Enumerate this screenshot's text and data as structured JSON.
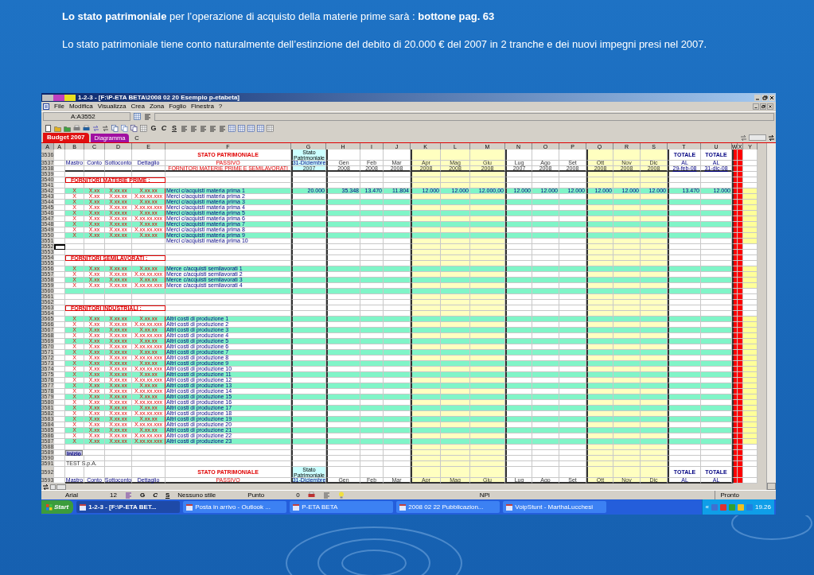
{
  "slide": {
    "title": "**Lo stato patrimoniale** per l’operazione di acquisto della materie prime sarà : **bottone pag. 63**",
    "text": "Lo stato patrimoniale tiene conto naturalmente dell’estinzione del debito di 20.000 € del 2007 in 2 tranche e dei nuovi impegni presi nel 2007."
  },
  "window": {
    "title": "1-2-3 - [F:\\P-ETA BETA\\2008 02 20  Esempio p-etabeta]"
  },
  "menu": [
    "File",
    "Modifica",
    "Visualizza",
    "Crea",
    "Zona",
    "Foglio",
    "Finestra",
    "?"
  ],
  "address": "A:A3552",
  "toolbar_letters": [
    "G",
    "C",
    "S"
  ],
  "tabs": [
    {
      "label": "Budget 2007",
      "selected": true,
      "color": "#e01010"
    },
    {
      "label": "Diagramma",
      "selected": false,
      "color": "#a010a0"
    },
    {
      "label": "C",
      "selected": false
    }
  ],
  "columns": [
    "A",
    "A",
    "B",
    "C",
    "D",
    "E",
    "F",
    "G",
    "H",
    "I",
    "J",
    "K",
    "L",
    "M",
    "N",
    "O",
    "P",
    "Q",
    "R",
    "S",
    "T",
    "U",
    "W",
    "X",
    "Y"
  ],
  "rows": [
    {
      "kind": "header",
      "numbers": [
        "3536",
        "3537",
        "3538"
      ],
      "labels": [
        "Mastro",
        "Conto",
        "Sottoconto",
        "Dettaglio"
      ],
      "title": "STATO PATRIMONIALE",
      "subtitle": "PASSIVO",
      "section": "FORNITORI MATERIE PRIME E SEMILAVORATI",
      "opening": {
        "title": "Stato Patrimoniale",
        "date": "31-Diciembre",
        "year": "2007"
      },
      "months": [
        {
          "name": "Gen",
          "year": "2008",
          "highlight": false
        },
        {
          "name": "Feb",
          "year": "2008",
          "highlight": false
        },
        {
          "name": "Mar",
          "year": "2008",
          "highlight": false
        },
        {
          "name": "Apr",
          "year": "2008",
          "highlight": true
        },
        {
          "name": "Mag",
          "year": "2008",
          "highlight": true
        },
        {
          "name": "Giu",
          "year": "2008",
          "highlight": true
        },
        {
          "name": "Lug",
          "year": "2007",
          "highlight": false
        },
        {
          "name": "Ago",
          "year": "2008",
          "highlight": false
        },
        {
          "name": "Set",
          "year": "2008",
          "highlight": false
        },
        {
          "name": "Ott",
          "year": "2008",
          "highlight": true
        },
        {
          "name": "Nov",
          "year": "2008",
          "highlight": true
        },
        {
          "name": "Dic",
          "year": "2008",
          "highlight": true
        }
      ],
      "totals": [
        {
          "label": "TOTALE",
          "al": "AL",
          "date": "29-feb-08"
        },
        {
          "label": "TOTALE",
          "al": "AL",
          "date": "31-dic-08"
        }
      ]
    },
    {
      "n": "3539",
      "kind": "blank",
      "shaded": false
    },
    {
      "n": "3540",
      "kind": "section",
      "label": "FORNITORI MATERIE PRIME :"
    },
    {
      "n": "3541",
      "kind": "blank",
      "shaded": false
    },
    {
      "n": "3542",
      "kind": "item",
      "shaded": true,
      "cells": [
        "X",
        "X.xx",
        "X.xx.xx",
        "X.xx.xx"
      ],
      "label": "Merci c/acquisti materia prima 1",
      "values": [
        "20.000",
        "35.348",
        "13.470",
        "11.804",
        "12.000",
        "12.000",
        "12.000,00",
        "12.000",
        "12.000",
        "12.000",
        "12.000",
        "12.000",
        "12.000",
        "13.470",
        "12.000"
      ]
    },
    {
      "n": "3543",
      "kind": "item",
      "shaded": false,
      "cells": [
        "X",
        "X.xx",
        "X.xx.xx",
        "X.xx.xx.xxx"
      ],
      "label": "Merci c/acquisti materia prima 2"
    },
    {
      "n": "3544",
      "kind": "item",
      "shaded": true,
      "cells": [
        "X",
        "X.xx",
        "X.xx.xx",
        "X.xx.xx"
      ],
      "label": "Merci c/acquisti materia prima 3"
    },
    {
      "n": "3545",
      "kind": "item",
      "shaded": false,
      "cells": [
        "X",
        "X.xx",
        "X.xx.xx",
        "X.xx.xx.xxx"
      ],
      "label": "Merci c/acquisti materia prima 4"
    },
    {
      "n": "3546",
      "kind": "item",
      "shaded": true,
      "cells": [
        "X",
        "X.xx",
        "X.xx.xx",
        "X.xx.xx"
      ],
      "label": "Merci c/acquisti materia prima 5"
    },
    {
      "n": "3547",
      "kind": "item",
      "shaded": false,
      "cells": [
        "X",
        "X.xx",
        "X.xx.xx",
        "X.xx.xx.xxx"
      ],
      "label": "Merci c/acquisti materia prima 6"
    },
    {
      "n": "3548",
      "kind": "item",
      "shaded": true,
      "cells": [
        "X",
        "X.xx",
        "X.xx.xx",
        "X.xx.xx"
      ],
      "label": "Merci c/acquisti materia prima 7"
    },
    {
      "n": "3549",
      "kind": "item",
      "shaded": false,
      "cells": [
        "X",
        "X.xx",
        "X.xx.xx",
        "X.xx.xx.xxx"
      ],
      "label": "Merci c/acquisti materia prima 8"
    },
    {
      "n": "3550",
      "kind": "item",
      "shaded": true,
      "cells": [
        "X",
        "X.xx",
        "X.xx.xx",
        "X.xx.xx"
      ],
      "label": "Merci c/acquisti materia prima 9"
    },
    {
      "n": "3551",
      "kind": "item",
      "shaded": false,
      "label": "Merci c/acquisti materia prima 10"
    },
    {
      "n": "3552",
      "kind": "blank",
      "shaded": false,
      "cursor": true
    },
    {
      "n": "3553",
      "kind": "blank",
      "shaded": false
    },
    {
      "n": "3554",
      "kind": "section",
      "label": "FORNITORI SEMILAVORATI :"
    },
    {
      "n": "3555",
      "kind": "blank",
      "shaded": false
    },
    {
      "n": "3556",
      "kind": "item",
      "shaded": true,
      "cells": [
        "X",
        "X.xx",
        "X.xx.xx",
        "X.xx.xx"
      ],
      "label": "Merce c/acquisti semilavorati 1"
    },
    {
      "n": "3557",
      "kind": "item",
      "shaded": false,
      "cells": [
        "X",
        "X.xx",
        "X.xx.xx",
        "X.xx.xx.xxx"
      ],
      "label": "Merce c/acquisti semilavorati 2"
    },
    {
      "n": "3558",
      "kind": "item",
      "shaded": true,
      "cells": [
        "X",
        "X.xx",
        "X.xx.xx",
        "X.xx.xx"
      ],
      "label": "Merce c/acquisti semilavorati 3"
    },
    {
      "n": "3559",
      "kind": "item",
      "shaded": false,
      "cells": [
        "X",
        "X.xx",
        "X.xx.xx",
        "X.xx.xx.xxx"
      ],
      "label": "Merce c/acquisti semilavorati 4"
    },
    {
      "n": "3560",
      "kind": "blank",
      "shaded": true
    },
    {
      "n": "3561",
      "kind": "blank",
      "shaded": false
    },
    {
      "n": "3562",
      "kind": "blank",
      "shaded": false
    },
    {
      "n": "3563",
      "kind": "section",
      "label": "FORNITORI INDUSTRIALI :"
    },
    {
      "n": "3564",
      "kind": "blank",
      "shaded": false
    },
    {
      "n": "3565",
      "kind": "item",
      "shaded": true,
      "cells": [
        "X",
        "X.xx",
        "X.xx.xx",
        "X.xx.xx"
      ],
      "label": "Altri costi di produzione 1"
    },
    {
      "n": "3566",
      "kind": "item",
      "shaded": false,
      "cells": [
        "X",
        "X.xx",
        "X.xx.xx",
        "X.xx.xx.xxx"
      ],
      "label": "Altri costi di produzione 2"
    },
    {
      "n": "3567",
      "kind": "item",
      "shaded": true,
      "cells": [
        "X",
        "X.xx",
        "X.xx.xx",
        "X.xx.xx"
      ],
      "label": "Altri costi di produzione 3"
    },
    {
      "n": "3568",
      "kind": "item",
      "shaded": false,
      "cells": [
        "X",
        "X.xx",
        "X.xx.xx",
        "X.xx.xx.xxx"
      ],
      "label": "Altri costi di produzione 4"
    },
    {
      "n": "3569",
      "kind": "item",
      "shaded": true,
      "cells": [
        "X",
        "X.xx",
        "X.xx.xx",
        "X.xx.xx"
      ],
      "label": "Altri costi di produzione 5"
    },
    {
      "n": "3570",
      "kind": "item",
      "shaded": false,
      "cells": [
        "X",
        "X.xx",
        "X.xx.xx",
        "X.xx.xx.xxx"
      ],
      "label": "Altri costi di produzione 6"
    },
    {
      "n": "3571",
      "kind": "item",
      "shaded": true,
      "cells": [
        "X",
        "X.xx",
        "X.xx.xx",
        "X.xx.xx"
      ],
      "label": "Altri costi di produzione 7"
    },
    {
      "n": "3572",
      "kind": "item",
      "shaded": false,
      "cells": [
        "X",
        "X.xx",
        "X.xx.xx",
        "X.xx.xx.xxx"
      ],
      "label": "Altri costi di produzione 8"
    },
    {
      "n": "3573",
      "kind": "item",
      "shaded": true,
      "cells": [
        "X",
        "X.xx",
        "X.xx.xx",
        "X.xx.xx"
      ],
      "label": "Altri costi di produzione 9"
    },
    {
      "n": "3574",
      "kind": "item",
      "shaded": false,
      "cells": [
        "X",
        "X.xx",
        "X.xx.xx",
        "X.xx.xx.xxx"
      ],
      "label": "Altri costi di produzione 10"
    },
    {
      "n": "3575",
      "kind": "item",
      "shaded": true,
      "cells": [
        "X",
        "X.xx",
        "X.xx.xx",
        "X.xx.xx"
      ],
      "label": "Altri costi di produzione 11"
    },
    {
      "n": "3576",
      "kind": "item",
      "shaded": false,
      "cells": [
        "X",
        "X.xx",
        "X.xx.xx",
        "X.xx.xx.xxx"
      ],
      "label": "Altri costi di produzione 12"
    },
    {
      "n": "3577",
      "kind": "item",
      "shaded": true,
      "cells": [
        "X",
        "X.xx",
        "X.xx.xx",
        "X.xx.xx"
      ],
      "label": "Altri costi di produzione 13"
    },
    {
      "n": "3578",
      "kind": "item",
      "shaded": false,
      "cells": [
        "X",
        "X.xx",
        "X.xx.xx",
        "X.xx.xx.xxx"
      ],
      "label": "Altri costi di produzione 14"
    },
    {
      "n": "3579",
      "kind": "item",
      "shaded": true,
      "cells": [
        "X",
        "X.xx",
        "X.xx.xx",
        "X.xx.xx"
      ],
      "label": "Altri costi di produzione 15"
    },
    {
      "n": "3580",
      "kind": "item",
      "shaded": false,
      "cells": [
        "X",
        "X.xx",
        "X.xx.xx",
        "X.xx.xx.xxx"
      ],
      "label": "Altri costi di produzione 16"
    },
    {
      "n": "3581",
      "kind": "item",
      "shaded": true,
      "cells": [
        "X",
        "X.xx",
        "X.xx.xx",
        "X.xx.xx"
      ],
      "label": "Altri costi di produzione 17"
    },
    {
      "n": "3582",
      "kind": "item",
      "shaded": false,
      "cells": [
        "X",
        "X.xx",
        "X.xx.xx",
        "X.xx.xx.xxx"
      ],
      "label": "Altri costi di produzione 18"
    },
    {
      "n": "3583",
      "kind": "item",
      "shaded": true,
      "cells": [
        "X",
        "X.xx",
        "X.xx.xx",
        "X.xx.xx"
      ],
      "label": "Altri costi di produzione 19"
    },
    {
      "n": "3584",
      "kind": "item",
      "shaded": false,
      "cells": [
        "X",
        "X.xx",
        "X.xx.xx",
        "X.xx.xx.xxx"
      ],
      "label": "Altri costi di produzione 20"
    },
    {
      "n": "3585",
      "kind": "item",
      "shaded": true,
      "cells": [
        "X",
        "X.xx",
        "X.xx.xx",
        "X.xx.xx"
      ],
      "label": "Altri costi di produzione 21"
    },
    {
      "n": "3586",
      "kind": "item",
      "shaded": false,
      "cells": [
        "X",
        "X.xx",
        "X.xx.xx",
        "X.xx.xx.xxx"
      ],
      "label": "Altri costi di produzione 22"
    },
    {
      "n": "3587",
      "kind": "item",
      "shaded": true,
      "cells": [
        "X",
        "X.xx",
        "X.xx.xx",
        "X.xx.xx.xxx"
      ],
      "label": "Altri costi di produzione 23"
    },
    {
      "n": "3588",
      "kind": "blank",
      "shaded": false
    },
    {
      "n": "3589",
      "kind": "button",
      "label": "Inizio"
    },
    {
      "n": "3590",
      "kind": "blank",
      "shaded": false
    },
    {
      "n": "3591",
      "kind": "company",
      "label": "TEST S.p.A."
    },
    {
      "kind": "header",
      "numbers": [
        "3592",
        "3593"
      ],
      "labels": [
        "Mastro",
        "Conto",
        "Sottoconto",
        "Dettaglio"
      ],
      "title": "STATO PATRIMONIALE",
      "subtitle": "PASSIVO",
      "opening": {
        "title": "Stato Patrimoniale",
        "date": "31-Diciembre"
      },
      "months": [
        {
          "name": "Gen",
          "highlight": false
        },
        {
          "name": "Feb",
          "highlight": false
        },
        {
          "name": "Mar",
          "highlight": false
        },
        {
          "name": "Apr",
          "highlight": true
        },
        {
          "name": "Mag",
          "highlight": true
        },
        {
          "name": "Giu",
          "highlight": true
        },
        {
          "name": "Lug",
          "highlight": false
        },
        {
          "name": "Ago",
          "highlight": false
        },
        {
          "name": "Set",
          "highlight": false
        },
        {
          "name": "Ott",
          "highlight": true
        },
        {
          "name": "Nov",
          "highlight": true
        },
        {
          "name": "Dic",
          "highlight": true
        }
      ],
      "totals": [
        {
          "label": "TOTALE",
          "al": "AL"
        },
        {
          "label": "TOTALE",
          "al": "AL"
        }
      ]
    }
  ],
  "format_bar": {
    "font": "Arial",
    "size": "12",
    "letters": [
      "G",
      "C",
      "S"
    ],
    "style": "Nessuno stile",
    "unit": "Punto",
    "value": "0"
  },
  "status": {
    "mode": "NPi",
    "state": "Pronto"
  },
  "taskbar": {
    "start": "Start",
    "tasks": [
      {
        "label": "1-2-3 - [F:\\P-ETA BET...",
        "selected": true
      },
      {
        "label": "Posta in arrivo - Outlook ...",
        "selected": false
      },
      {
        "label": "P-ETA BETA",
        "selected": false
      },
      {
        "label": "2008 02 22 Pubblicazion...",
        "selected": false
      },
      {
        "label": "VoipStunt - MarthaLucchesi",
        "selected": false
      }
    ],
    "tray_toggle": "«",
    "time": "19.26"
  }
}
